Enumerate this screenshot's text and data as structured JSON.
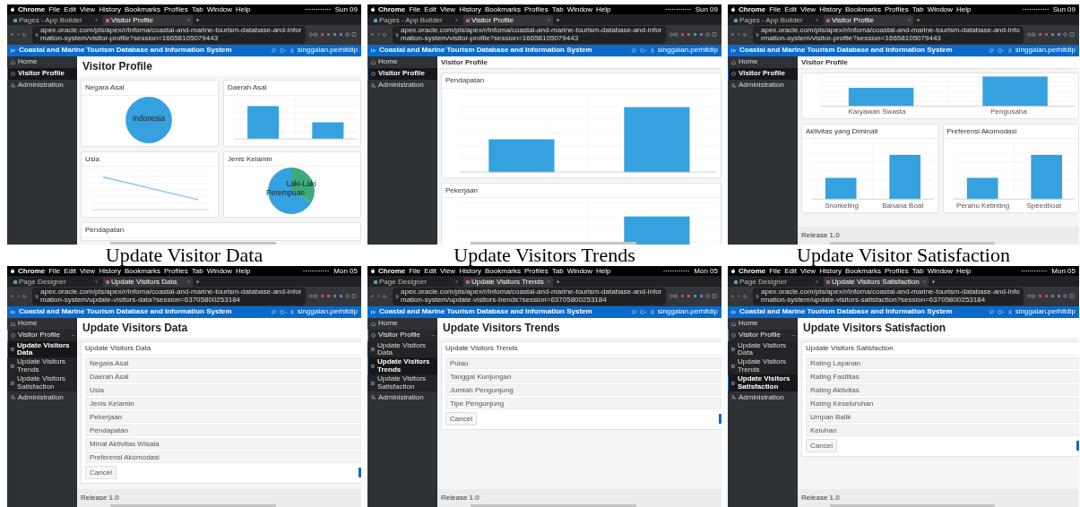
{
  "panels": [
    {
      "browser": {
        "menu_items": [
          "Chrome",
          "File",
          "Edit",
          "View",
          "History",
          "Bookmarks",
          "Profiles",
          "Tab",
          "Window",
          "Help"
        ],
        "clock": "Sun 09",
        "tabs": [
          {
            "label": "Pages - App Builder",
            "selected": false
          },
          {
            "label": "Visitor Profile",
            "selected": true
          }
        ],
        "url": "apex.oracle.com/pls/apex/r/infoma/coastal-and-marine-tourism-database-and-information-system/visitor-profile?session=16658105079443"
      },
      "app": {
        "title": "Coastal and Marine Tourism Database and Information System",
        "user": "singgalan.perhitdip"
      },
      "sidebar": [
        {
          "label": "Home",
          "kind": "home",
          "selected": false
        },
        {
          "label": "Visitor Profile",
          "kind": "gauge",
          "selected": true
        },
        {
          "label": "Administration",
          "kind": "admin",
          "selected": false
        }
      ],
      "page": {
        "kind": "dashboard",
        "header": {
          "kind": "large",
          "title": "Visitor Profile"
        },
        "rows": [
          [
            {
              "title": "Negara Asal",
              "chart": {
                "kind": "pie",
                "slices": [
                  {
                    "label": "Indonesia",
                    "color": "#36a1df"
                  }
                ]
              }
            },
            {
              "title": "Daerah Asal",
              "chart": {
                "kind": "bar"
              }
            }
          ],
          [
            {
              "title": "Usia",
              "chart": {
                "kind": "line"
              }
            },
            {
              "title": "Jenis Kelamin",
              "chart": {
                "kind": "pie",
                "slices": [
                  {
                    "label": "Laki-Laki",
                    "color": "#3daa7a"
                  },
                  {
                    "label": "Perempuan",
                    "color": "#36a1df"
                  }
                ]
              }
            }
          ],
          [
            {
              "title": "Pendapatan"
            }
          ]
        ]
      },
      "caption": "Update Visitor Data"
    },
    {
      "browser": {
        "menu_items": [
          "Chrome",
          "File",
          "Edit",
          "View",
          "History",
          "Bookmarks",
          "Profiles",
          "Tab",
          "Window",
          "Help"
        ],
        "clock": "Sun 09",
        "tabs": [
          {
            "label": "Pages - App Builder",
            "selected": false
          },
          {
            "label": "Visitor Profile",
            "selected": true
          }
        ],
        "url": "apex.oracle.com/pls/apex/r/infoma/coastal-and-marine-tourism-database-and-information-system/visitor-profile?session=16658105079443"
      },
      "app": {
        "title": "Coastal and Marine Tourism Database and Information System",
        "user": "singgalan.perhitdip"
      },
      "sidebar": [
        {
          "label": "Home",
          "kind": "home",
          "selected": false
        },
        {
          "label": "Visitor Profile",
          "kind": "gauge",
          "selected": true
        },
        {
          "label": "Administration",
          "kind": "admin",
          "selected": false
        }
      ],
      "page": {
        "kind": "dashboard",
        "header": {
          "kind": "compact",
          "title": "Visitor Profile"
        },
        "rows": [
          [
            {
              "title": "Pendapatan",
              "chart": {
                "kind": "bar"
              }
            }
          ],
          [
            {
              "title": "Pekerjaan",
              "chart": {
                "kind": "bar"
              }
            }
          ]
        ]
      },
      "caption": "Update Visitors Trends"
    },
    {
      "browser": {
        "menu_items": [
          "Chrome",
          "File",
          "Edit",
          "View",
          "History",
          "Bookmarks",
          "Profiles",
          "Tab",
          "Window",
          "Help"
        ],
        "clock": "Sun 09",
        "tabs": [
          {
            "label": "Pages - App Builder",
            "selected": false
          },
          {
            "label": "Visitor Profile",
            "selected": true
          }
        ],
        "url": "apex.oracle.com/pls/apex/r/infoma/coastal-and-marine-tourism-database-and-information-system/visitor-profile?session=16658105079443"
      },
      "app": {
        "title": "Coastal and Marine Tourism Database and Information System",
        "user": "singgalan.perhitdip"
      },
      "sidebar": [
        {
          "label": "Home",
          "kind": "home",
          "selected": false
        },
        {
          "label": "Visitor Profile",
          "kind": "gauge",
          "selected": true
        },
        {
          "label": "Administration",
          "kind": "admin",
          "selected": false
        }
      ],
      "page": {
        "kind": "dashboard",
        "header": {
          "kind": "compact",
          "title": "Visitor Profile"
        },
        "rows": [
          [
            {
              "chart": {
                "kind": "bar",
                "categories": [
                  "Karyawan Swasta",
                  "Pengusaha"
                ]
              }
            }
          ],
          [
            {
              "title": "Aktivitas yang Diminati",
              "chart": {
                "kind": "bar",
                "categories": [
                  "Snorkeling",
                  "Banana Boat"
                ]
              }
            },
            {
              "title": "Preferensi Akomodasi",
              "chart": {
                "kind": "bar",
                "categories": [
                  "Perahu Ketinting",
                  "Speedboat"
                ]
              }
            }
          ]
        ],
        "footer": "Release 1.0"
      },
      "caption": "Update Visitor Satisfaction"
    },
    {
      "browser": {
        "menu_items": [
          "Chrome",
          "File",
          "Edit",
          "View",
          "History",
          "Bookmarks",
          "Profiles",
          "Tab",
          "Window",
          "Help"
        ],
        "clock": "Mon 05",
        "tabs": [
          {
            "label": "Page Designer",
            "selected": false
          },
          {
            "label": "Update Visitors Data",
            "selected": true
          }
        ],
        "url": "apex.oracle.com/pls/apex/r/infoma/coastal-and-marine-tourism-database-and-information-system/update-visitors-data?session=63705800253184"
      },
      "app": {
        "title": "Coastal and Marine Tourism Database and Information System",
        "user": "singgalan.perhitdip"
      },
      "sidebar": [
        {
          "label": "Home",
          "kind": "home",
          "selected": false
        },
        {
          "label": "Visitor Profile",
          "kind": "gauge",
          "selected": false,
          "expanded": true,
          "children": [
            {
              "label": "Update Visitors Data",
              "kind": "page",
              "selected": true
            },
            {
              "label": "Update Visitors Trends",
              "kind": "page",
              "selected": false
            },
            {
              "label": "Update Visitors Satisfaction",
              "kind": "page",
              "selected": false
            }
          ]
        },
        {
          "label": "Administration",
          "kind": "admin",
          "selected": false
        }
      ],
      "page": {
        "kind": "form",
        "header": {
          "kind": "large",
          "title": "Update Visitors Data"
        },
        "region_title": "Update Visitors Data",
        "fields": [
          {
            "placeholder": "Negara Asal"
          },
          {
            "placeholder": "Daerah Asal"
          },
          {
            "placeholder": "Usia"
          },
          {
            "placeholder": "Jenis Kelamin"
          },
          {
            "placeholder": "Pekerjaan"
          },
          {
            "placeholder": "Pendapatan"
          },
          {
            "placeholder": "Minat Aktivitas Wisata"
          },
          {
            "placeholder": "Preferensi Akomodasi"
          }
        ],
        "buttons": [
          {
            "kind": "secondary",
            "label": "Cancel"
          },
          {
            "kind": "primary"
          }
        ],
        "footer": "Release 1.0"
      }
    },
    {
      "browser": {
        "menu_items": [
          "Chrome",
          "File",
          "Edit",
          "View",
          "History",
          "Bookmarks",
          "Profiles",
          "Tab",
          "Window",
          "Help"
        ],
        "clock": "Mon 05",
        "tabs": [
          {
            "label": "Page Designer",
            "selected": false
          },
          {
            "label": "Update Visitors Trends",
            "selected": true
          }
        ],
        "url": "apex.oracle.com/pls/apex/r/infoma/coastal-and-marine-tourism-database-and-information-system/update-visitors-trends?session=63705800253184"
      },
      "app": {
        "title": "Coastal and Marine Tourism Database and Information System",
        "user": "singgalan.perhitdip"
      },
      "sidebar": [
        {
          "label": "Home",
          "kind": "home",
          "selected": false
        },
        {
          "label": "Visitor Profile",
          "kind": "gauge",
          "selected": false,
          "expanded": true,
          "children": [
            {
              "label": "Update Visitors Data",
              "kind": "page",
              "selected": false
            },
            {
              "label": "Update Visitors Trends",
              "kind": "page",
              "selected": true
            },
            {
              "label": "Update Visitors Satisfaction",
              "kind": "page",
              "selected": false
            }
          ]
        },
        {
          "label": "Administration",
          "kind": "admin",
          "selected": false
        }
      ],
      "page": {
        "kind": "form",
        "header": {
          "kind": "large",
          "title": "Update Visitors Trends"
        },
        "region_title": "Update Visitors Trends",
        "fields": [
          {
            "placeholder": "Pulau"
          },
          {
            "placeholder": "Tanggal Kunjungan"
          },
          {
            "placeholder": "Jumlah Pengunjung"
          },
          {
            "placeholder": "Tipe Pengunjung"
          }
        ],
        "buttons": [
          {
            "kind": "secondary",
            "label": "Cancel"
          },
          {
            "kind": "primary"
          }
        ],
        "footer": "Release 1.0"
      }
    },
    {
      "browser": {
        "menu_items": [
          "Chrome",
          "File",
          "Edit",
          "View",
          "History",
          "Bookmarks",
          "Profiles",
          "Tab",
          "Window",
          "Help"
        ],
        "clock": "Mon 05",
        "tabs": [
          {
            "label": "Page Designer",
            "selected": false
          },
          {
            "label": "Update Visitors Satisfaction",
            "selected": true
          }
        ],
        "url": "apex.oracle.com/pls/apex/r/infoma/coastal-and-marine-tourism-database-and-information-system/update-visitors-satisfaction?session=63705800253184"
      },
      "app": {
        "title": "Coastal and Marine Tourism Database and Information System",
        "user": "singgalan.perhitdip"
      },
      "sidebar": [
        {
          "label": "Home",
          "kind": "home",
          "selected": false
        },
        {
          "label": "Visitor Profile",
          "kind": "gauge",
          "selected": false,
          "expanded": true,
          "children": [
            {
              "label": "Update Visitors Data",
              "kind": "page",
              "selected": false
            },
            {
              "label": "Update Visitors Trends",
              "kind": "page",
              "selected": false
            },
            {
              "label": "Update Visitors Satisfaction",
              "kind": "page",
              "selected": true
            }
          ]
        },
        {
          "label": "Administration",
          "kind": "admin",
          "selected": false
        }
      ],
      "page": {
        "kind": "form",
        "header": {
          "kind": "large",
          "title": "Update Visitors Satisfaction"
        },
        "region_title": "Update Visitors Satisfaction",
        "fields": [
          {
            "placeholder": "Rating Layanan"
          },
          {
            "placeholder": "Rating Fasilitas"
          },
          {
            "placeholder": "Rating Aktivitas"
          },
          {
            "placeholder": "Rating Keseluruhan"
          },
          {
            "placeholder": "Umpan Balik"
          },
          {
            "placeholder": "Keluhan"
          }
        ],
        "buttons": [
          {
            "kind": "secondary",
            "label": "Cancel"
          },
          {
            "kind": "primary"
          }
        ],
        "footer": "Release 1.0"
      }
    }
  ]
}
